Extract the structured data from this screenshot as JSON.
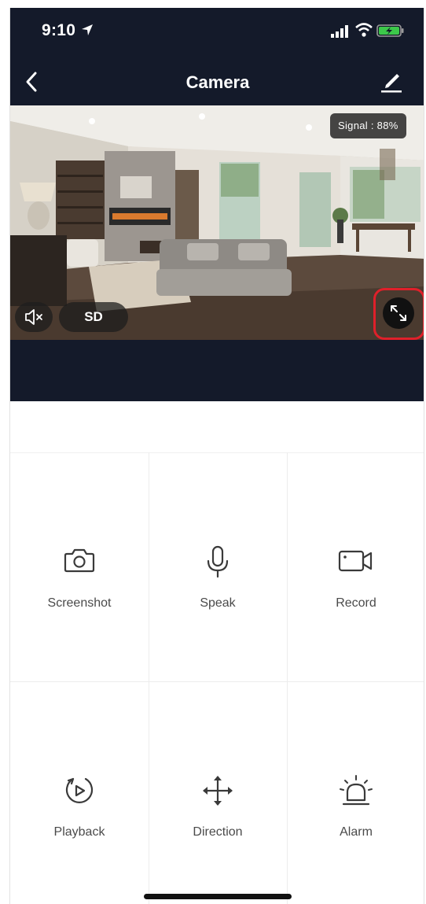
{
  "status_bar": {
    "time": "9:10"
  },
  "nav": {
    "title": "Camera"
  },
  "video": {
    "signal_text": "Signal : 88%",
    "quality_label": "SD"
  },
  "controls": [
    {
      "label": "Screenshot",
      "icon": "camera-icon"
    },
    {
      "label": "Speak",
      "icon": "microphone-icon"
    },
    {
      "label": "Record",
      "icon": "video-camera-icon"
    },
    {
      "label": "Playback",
      "icon": "playback-icon"
    },
    {
      "label": "Direction",
      "icon": "move-arrows-icon"
    },
    {
      "label": "Alarm",
      "icon": "alarm-siren-icon"
    }
  ],
  "colors": {
    "header_bg": "#141a2a",
    "highlight": "#e0202a"
  }
}
